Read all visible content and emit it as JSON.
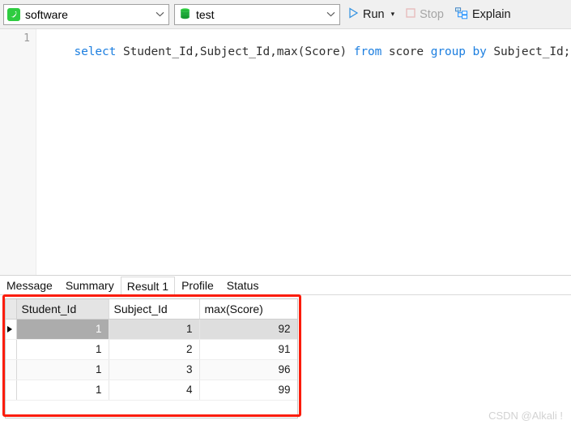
{
  "toolbar": {
    "connection": {
      "icon": "mysql-dolphin-icon",
      "value": "software"
    },
    "database": {
      "icon": "database-cylinder-icon",
      "value": "test"
    },
    "run": {
      "label": "Run",
      "icon": "play-triangle-icon",
      "caret": "▾"
    },
    "stop": {
      "label": "Stop",
      "icon": "stop-square-icon",
      "disabled": true
    },
    "explain": {
      "label": "Explain",
      "icon": "explain-tree-icon"
    }
  },
  "editor": {
    "line_number": "1",
    "code_tokens": [
      {
        "text": "select",
        "type": "keyword"
      },
      {
        "text": " Student_Id,Subject_Id,max(Score) ",
        "type": "plain"
      },
      {
        "text": "from",
        "type": "keyword"
      },
      {
        "text": " score ",
        "type": "plain"
      },
      {
        "text": "group",
        "type": "keyword"
      },
      {
        "text": " ",
        "type": "plain"
      },
      {
        "text": "by",
        "type": "keyword"
      },
      {
        "text": " Subject_Id;",
        "type": "plain"
      }
    ],
    "code_text": "select Student_Id,Subject_Id,max(Score) from score group by Subject_Id;"
  },
  "result_tabs": [
    {
      "label": "Message",
      "active": false
    },
    {
      "label": "Summary",
      "active": false
    },
    {
      "label": "Result 1",
      "active": true
    },
    {
      "label": "Profile",
      "active": false
    },
    {
      "label": "Status",
      "active": false
    }
  ],
  "result_grid": {
    "columns": [
      "Student_Id",
      "Subject_Id",
      "max(Score)"
    ],
    "selected_column_index": 0,
    "selected_row_index": 0,
    "rows": [
      [
        "1",
        "1",
        "92"
      ],
      [
        "1",
        "2",
        "91"
      ],
      [
        "1",
        "3",
        "96"
      ],
      [
        "1",
        "4",
        "99"
      ]
    ]
  },
  "annotation": {
    "color": "#fb1c0a"
  },
  "watermark": {
    "text": "CSDN @Alkali !"
  },
  "colors": {
    "keyword": "#1d7fe0",
    "toolbar_bg": "#f0f0f0",
    "accent_green": "#2ecc40",
    "annotation_red": "#fb1c0a"
  }
}
